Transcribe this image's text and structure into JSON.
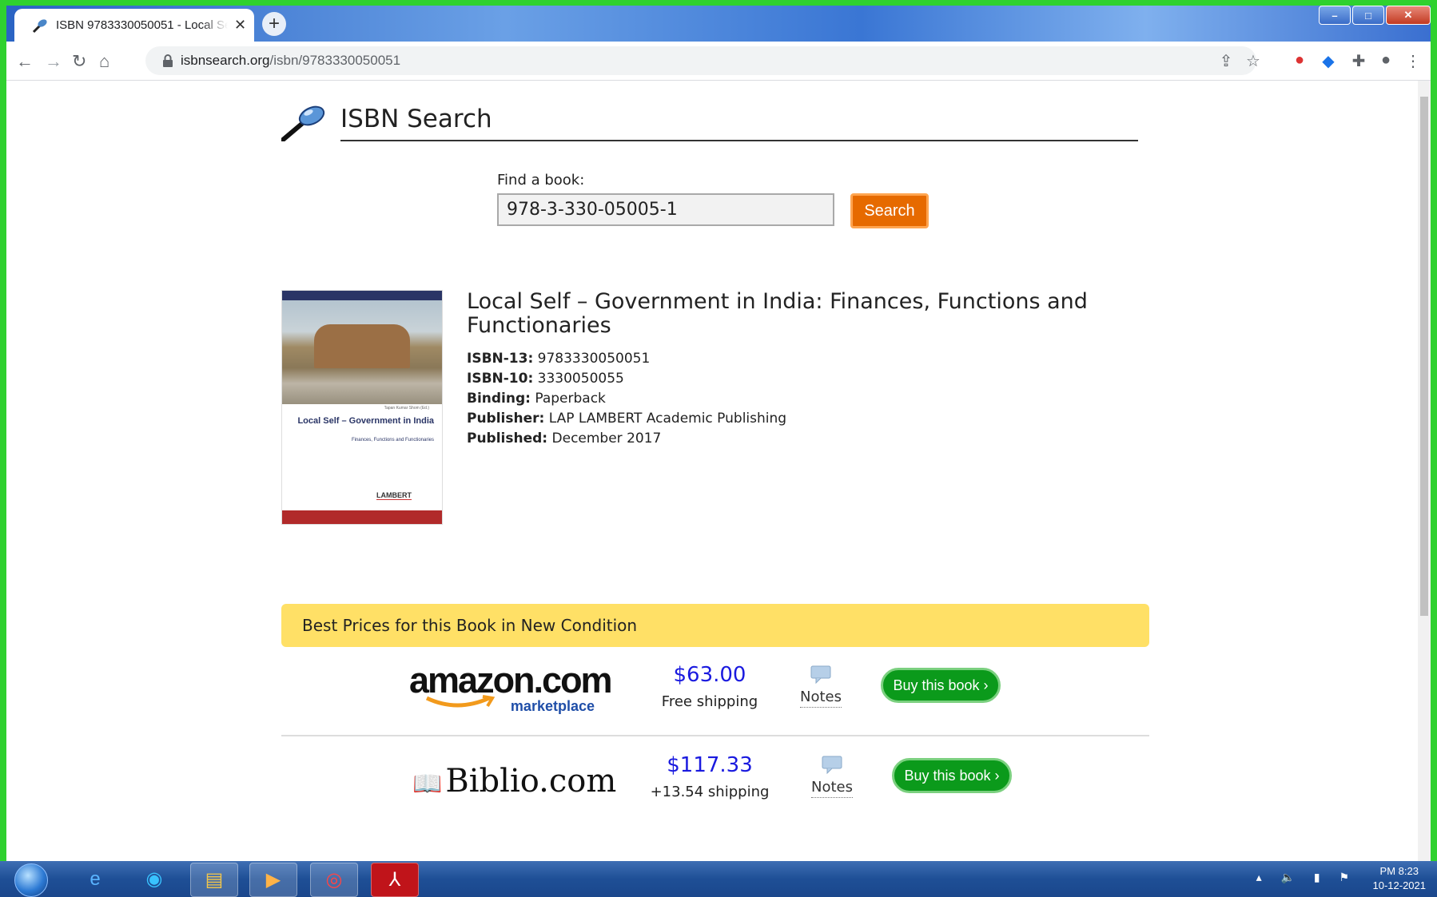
{
  "browser": {
    "tab_title": "ISBN 9783330050051 - Local Self",
    "new_tab_label": "+",
    "url_domain": "isbnsearch.org",
    "url_path": "/isbn/9783330050051"
  },
  "site": {
    "title": "ISBN Search"
  },
  "search": {
    "label": "Find a book:",
    "value": "978-3-330-05005-1",
    "button": "Search"
  },
  "book": {
    "title": "Local Self – Government in India: Finances, Functions and Functionaries",
    "isbn13_label": "ISBN-13:",
    "isbn13": "9783330050051",
    "isbn10_label": "ISBN-10:",
    "isbn10": "3330050055",
    "binding_label": "Binding:",
    "binding": "Paperback",
    "publisher_label": "Publisher:",
    "publisher": "LAP LAMBERT Academic Publishing",
    "published_label": "Published:",
    "published": "December 2017",
    "cover": {
      "author": "Tapan Kumar Shom (Ed.)",
      "title": "Local Self – Government in India",
      "subtitle": "Finances, Functions and Functionaries",
      "publisher_logo": "LAMBERT"
    }
  },
  "prices": {
    "header": "Best Prices for this Book in New Condition",
    "offers": [
      {
        "seller_logo": "amazon.com",
        "seller_sub": "marketplace",
        "price": "$63.00",
        "shipping": "Free shipping",
        "notes": "Notes",
        "buy": "Buy this book ›"
      },
      {
        "seller_logo": "Biblio.com",
        "price": "$117.33",
        "shipping": "+13.54 shipping",
        "notes": "Notes",
        "buy": "Buy this book ›"
      }
    ]
  },
  "taskbar": {
    "time": "PM 8:23",
    "date": "10-12-2021"
  }
}
